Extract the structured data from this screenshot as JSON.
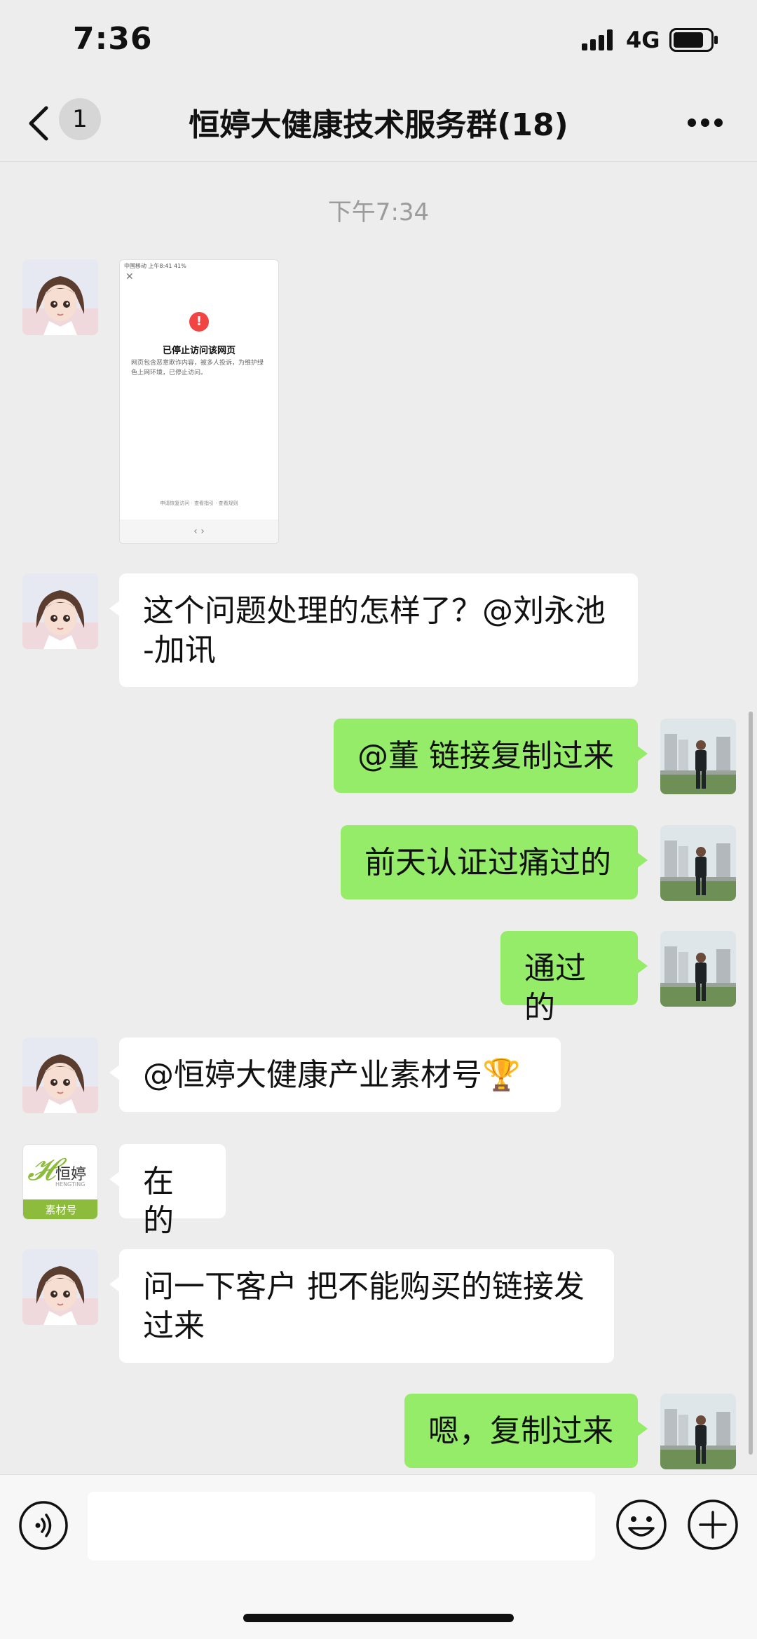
{
  "status_bar": {
    "time": "7:36",
    "network": "4G"
  },
  "nav": {
    "unread_count": "1",
    "title": "恒婷大健康技术服务群(18)"
  },
  "timestamp": "下午7:34",
  "screenshot_card": {
    "status_text": "中国移动  上午8:41  41%",
    "heading": "已停止访问该网页",
    "body": "网页包含恶意欺诈内容，被多人投诉，为维护绿色上网环境，已停止访问。",
    "footer": "申请恢复访问 · 查看指引 · 查看规则",
    "nav_glyphs": "‹      ›"
  },
  "messages": [
    {
      "side": "left",
      "text": "这个问题处理的怎样了？@刘永池\n-加讯"
    },
    {
      "side": "right",
      "text": "@董 链接复制过来"
    },
    {
      "side": "right",
      "text": "前天认证过痛过的"
    },
    {
      "side": "right",
      "text": "通过的"
    },
    {
      "side": "left",
      "text": "@恒婷大健康产业素材号🏆"
    },
    {
      "side": "left",
      "text": "在的"
    },
    {
      "side": "left",
      "text": "问一下客户 把不能购买的链接发\n过来"
    },
    {
      "side": "right",
      "text": "嗯，复制过来"
    }
  ],
  "brand_avatar": {
    "name": "恒婷",
    "sub": "HENGTING",
    "tag": "素材号",
    "color": "#8dbb3c"
  },
  "colors": {
    "bubble_right": "#95ec69",
    "bubble_left": "#ffffff",
    "background": "#ededed"
  },
  "icons": {
    "voice": "voice-icon",
    "emoji": "emoji-icon",
    "plus": "plus-icon",
    "back": "back-chevron-icon",
    "more": "more-dots-icon"
  }
}
